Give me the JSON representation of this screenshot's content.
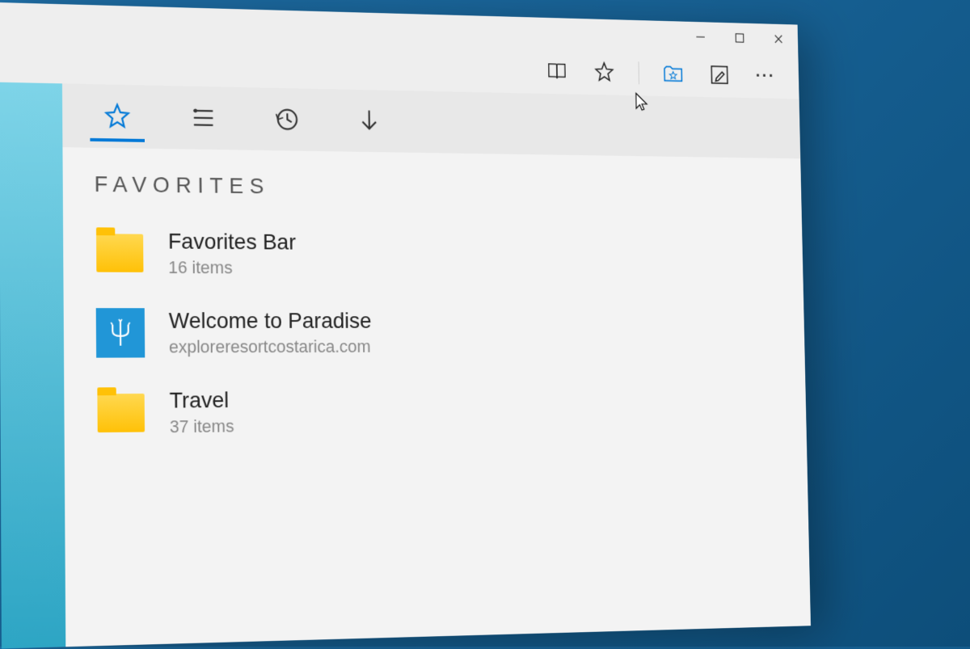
{
  "section_heading": "FAVORITES",
  "hub_tabs": {
    "favorites": "favorites",
    "reading_list": "reading-list",
    "history": "history",
    "downloads": "downloads"
  },
  "toolbar_icons": {
    "reading_view": "reading-view",
    "favorite_star": "add-favorite",
    "hub": "hub",
    "web_note": "web-note",
    "more": "more"
  },
  "favorites": [
    {
      "type": "folder",
      "title": "Favorites Bar",
      "subtitle": "16 items"
    },
    {
      "type": "site",
      "title": "Welcome to Paradise",
      "subtitle": "exploreresortcostarica.com",
      "icon": "trident"
    },
    {
      "type": "folder",
      "title": "Travel",
      "subtitle": "37 items"
    }
  ]
}
